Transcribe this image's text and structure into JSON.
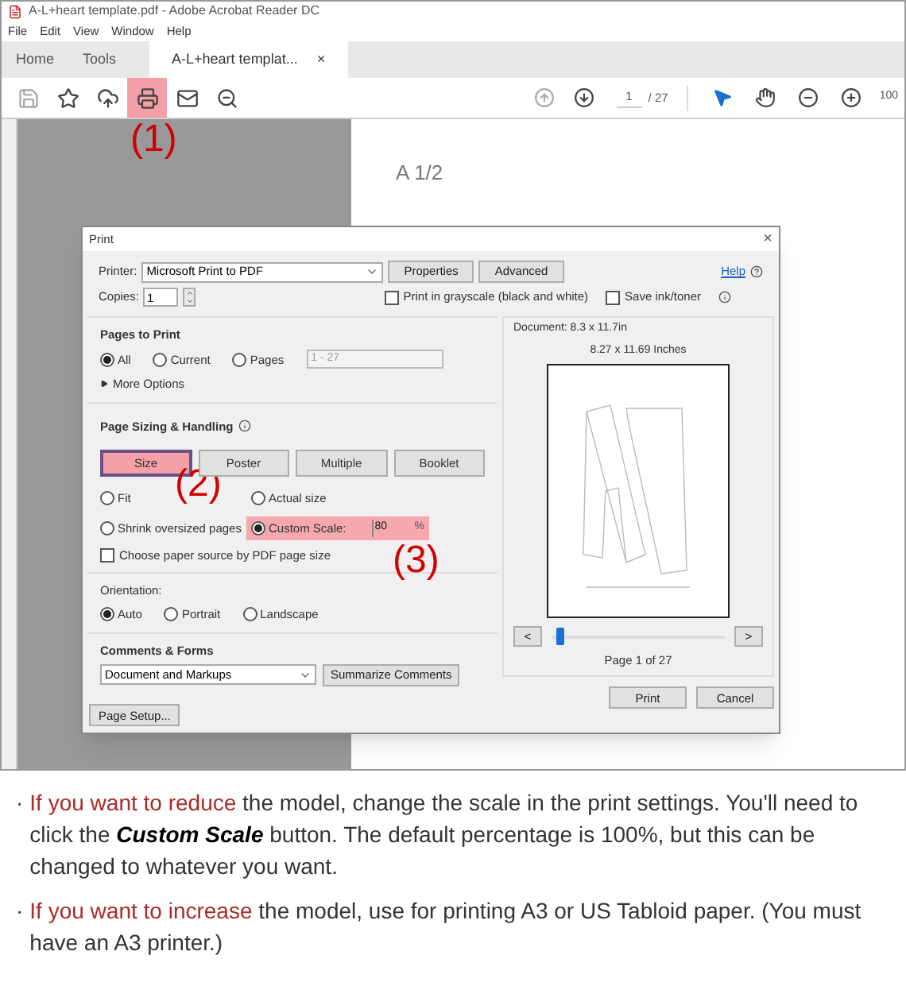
{
  "window": {
    "title": "A-L+heart template.pdf - Adobe Acrobat Reader DC"
  },
  "menu": [
    "File",
    "Edit",
    "View",
    "Window",
    "Help"
  ],
  "tabs": [
    {
      "label": "Home",
      "selected": false
    },
    {
      "label": "Tools",
      "selected": false
    },
    {
      "label": "A-L+heart templat...",
      "selected": true,
      "close": "×"
    }
  ],
  "toolbar": {
    "left": [
      {
        "kind": "save",
        "disabled": true,
        "highlighted": false
      },
      {
        "kind": "star",
        "disabled": false,
        "highlighted": false
      },
      {
        "kind": "upload",
        "disabled": false,
        "highlighted": false
      },
      {
        "kind": "print",
        "disabled": false,
        "highlighted": true,
        "annotation": "(1)"
      },
      {
        "kind": "mail",
        "disabled": false,
        "highlighted": false
      },
      {
        "kind": "zoom",
        "disabled": false,
        "highlighted": false
      }
    ],
    "page_current": "1",
    "page_total": "/ 27",
    "right": [
      {
        "kind": "pointer",
        "selected": true
      },
      {
        "kind": "hand",
        "selected": false
      },
      {
        "kind": "minus",
        "selected": false
      },
      {
        "kind": "plus",
        "selected": false
      }
    ],
    "zoom": "100"
  },
  "document": {
    "page_label": "A 1/2"
  },
  "dialog": {
    "title": "Print",
    "close": "×",
    "printer": {
      "label": "Printer:",
      "value": "Microsoft Print to PDF"
    },
    "buttons": [
      "Properties",
      "Advanced"
    ],
    "help": "Help",
    "copies": {
      "label": "Copies:",
      "value": "1"
    },
    "checkboxes": [
      {
        "label": "Print in grayscale (black and white)",
        "checked": false
      },
      {
        "label": "Save ink/toner",
        "checked": false
      }
    ],
    "pages_to_print": {
      "title": "Pages to Print",
      "options": [
        {
          "label": "All",
          "selected": true
        },
        {
          "label": "Current",
          "selected": false
        },
        {
          "label": "Pages",
          "selected": false
        }
      ],
      "range": "1 - 27",
      "more_options": "More Options"
    },
    "sizing": {
      "title": "Page Sizing & Handling",
      "modes": [
        {
          "label": "Size",
          "selected": true,
          "highlighted": true,
          "annotation": "(2)"
        },
        {
          "label": "Poster",
          "selected": false,
          "highlighted": false
        },
        {
          "label": "Multiple",
          "selected": false,
          "highlighted": false
        },
        {
          "label": "Booklet",
          "selected": false,
          "highlighted": false
        }
      ],
      "options": [
        {
          "label": "Fit",
          "selected": false,
          "highlighted": false
        },
        {
          "label": "Actual size",
          "selected": false,
          "highlighted": false
        },
        {
          "label": "Shrink oversized pages",
          "selected": false,
          "highlighted": false
        },
        {
          "label": "Custom Scale:",
          "selected": true,
          "highlighted": true,
          "annotation": "(3)",
          "value": "80",
          "unit": "%"
        }
      ],
      "paper_source": {
        "label": "Choose paper source by PDF page size",
        "checked": false
      }
    },
    "orientation": {
      "title": "Orientation:",
      "options": [
        {
          "label": "Auto",
          "selected": true
        },
        {
          "label": "Portrait",
          "selected": false
        },
        {
          "label": "Landscape",
          "selected": false
        }
      ]
    },
    "comments": {
      "title": "Comments & Forms",
      "value": "Document and Markups",
      "button": "Summarize Comments"
    },
    "page_setup": "Page Setup...",
    "preview": {
      "document": "Document: 8.3 x 11.7in",
      "size": "8.27 x 11.69 Inches",
      "prev": "<",
      "next": ">",
      "level": 0.03,
      "page_label": "Page 1 of 27"
    },
    "actions": [
      "Print",
      "Cancel"
    ]
  },
  "notes": [
    {
      "bullet": "·",
      "lead": "If you want to reduce",
      "text": " the model, change the scale in the print settings. You'll need to click the **Custom Scale** button. The default percentage is 100%, but this can be changed to whatever you want."
    },
    {
      "bullet": "·",
      "lead": "If you want to increase",
      "text": " the model, use for printing A3 or US Tabloid paper. (You must have an A3 printer.)"
    }
  ]
}
